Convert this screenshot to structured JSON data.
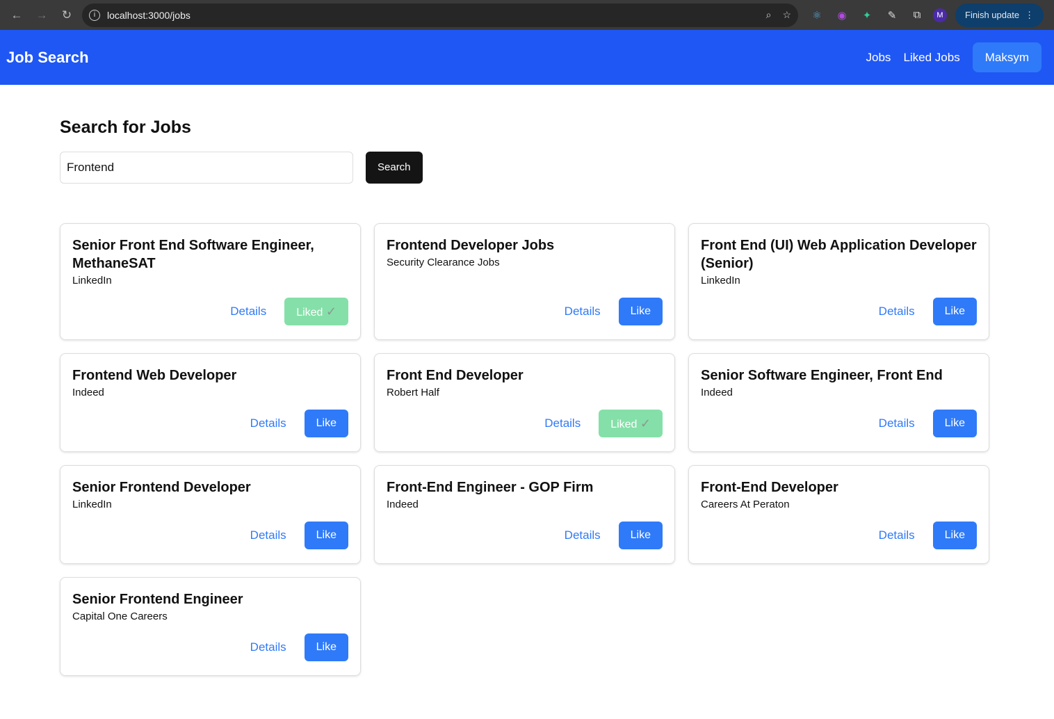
{
  "browser": {
    "url": "localhost:3000/jobs",
    "finish_update": "Finish update",
    "profile_initial": "M"
  },
  "header": {
    "title": "Job Search",
    "nav": [
      "Jobs",
      "Liked Jobs"
    ],
    "user": "Maksym"
  },
  "search": {
    "heading": "Search for Jobs",
    "value": "Frontend",
    "button": "Search"
  },
  "labels": {
    "details": "Details",
    "like": "Like",
    "liked": "Liked"
  },
  "jobs": [
    {
      "title": "Senior Front End Software Engineer, MethaneSAT",
      "company": "LinkedIn",
      "liked": true
    },
    {
      "title": "Frontend Developer Jobs",
      "company": "Security Clearance Jobs",
      "liked": false
    },
    {
      "title": "Front End (UI) Web Application Developer (Senior)",
      "company": "LinkedIn",
      "liked": false
    },
    {
      "title": "Frontend Web Developer",
      "company": "Indeed",
      "liked": false
    },
    {
      "title": "Front End Developer",
      "company": "Robert Half",
      "liked": true
    },
    {
      "title": "Senior Software Engineer, Front End",
      "company": "Indeed",
      "liked": false
    },
    {
      "title": "Senior Frontend Developer",
      "company": "LinkedIn",
      "liked": false
    },
    {
      "title": "Front-End Engineer - GOP Firm",
      "company": "Indeed",
      "liked": false
    },
    {
      "title": "Front-End Developer",
      "company": "Careers At Peraton",
      "liked": false
    },
    {
      "title": "Senior Frontend Engineer",
      "company": "Capital One Careers",
      "liked": false
    }
  ]
}
